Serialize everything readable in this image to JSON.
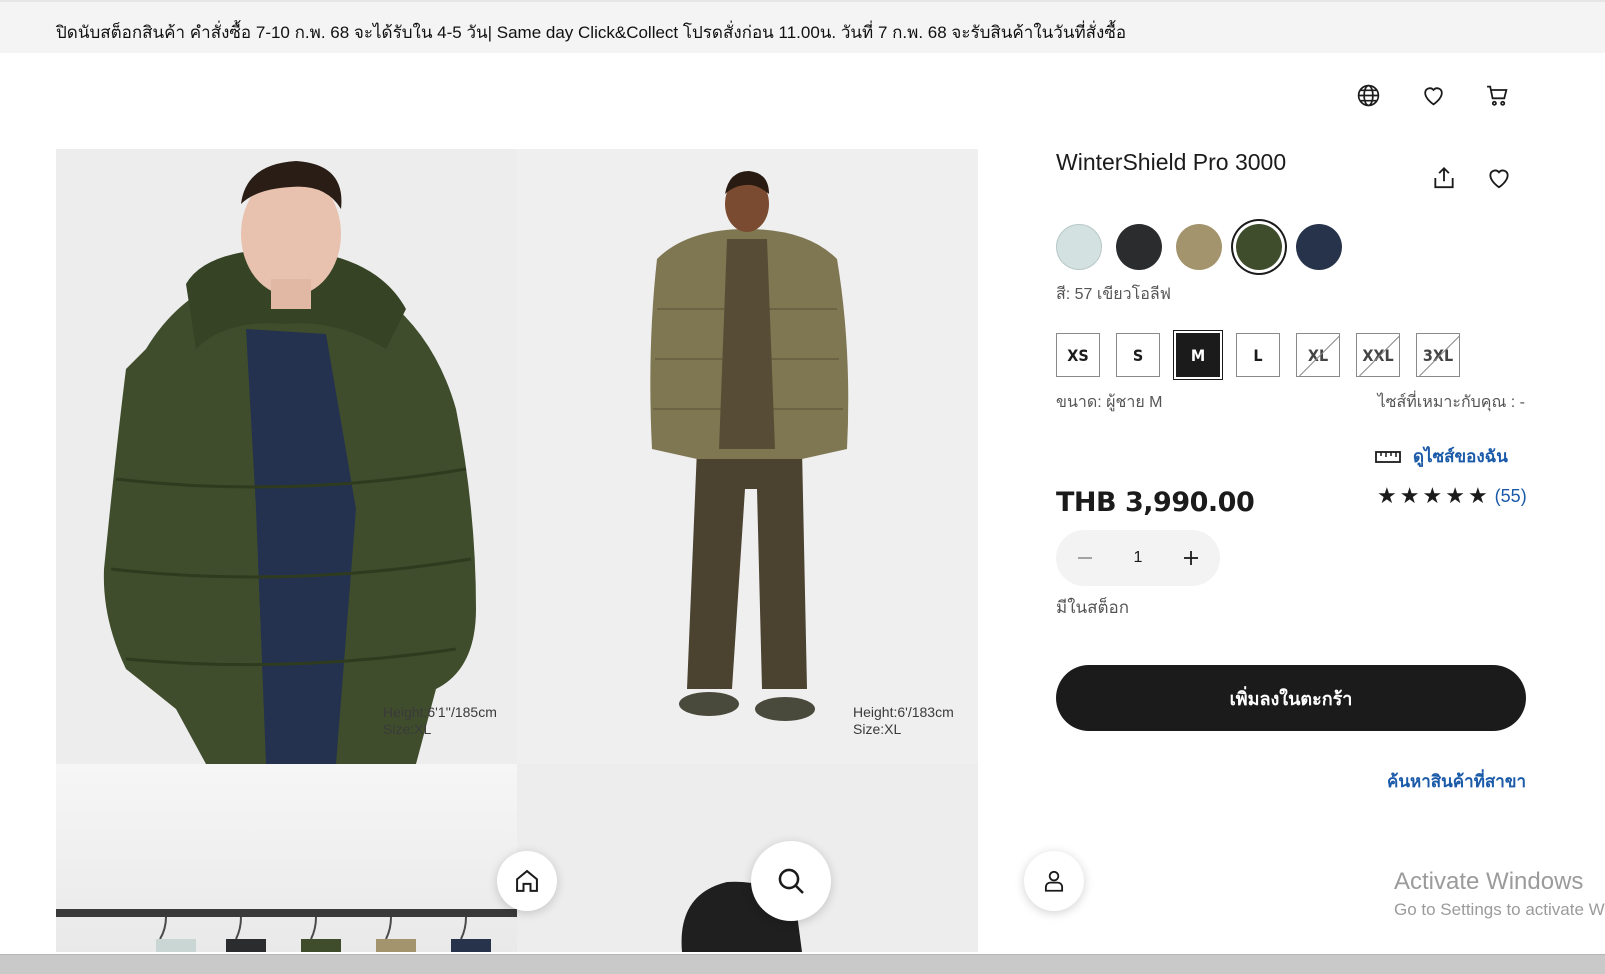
{
  "banner": {
    "text": "ปิดนับสต็อกสินค้า คำสั่งซื้อ 7-10 ก.พ. 68 จะได้รับใน 4-5 วัน| Same day Click&Collect โปรดสั่งก่อน 11.00น. วันที่ 7 ก.พ. 68 จะรับสินค้าในวันที่สั่งซื้อ"
  },
  "header": {
    "icons": [
      "globe-icon",
      "heart-icon",
      "cart-icon"
    ]
  },
  "gallery": {
    "captions": [
      {
        "height": "Height:6'1''/185cm",
        "size": "Size:XL"
      },
      {
        "height": "Height:6'/183cm",
        "size": "Size:XL"
      }
    ]
  },
  "product": {
    "title": "WinterShield Pro 3000",
    "color_label": "สี: 57 เขียวโอลีฟ",
    "colors": [
      {
        "name": "light-blue",
        "hex": "#d3e1e0"
      },
      {
        "name": "black",
        "hex": "#2b2c2e"
      },
      {
        "name": "beige",
        "hex": "#a4946d"
      },
      {
        "name": "olive",
        "hex": "#3f4d2c"
      },
      {
        "name": "navy",
        "hex": "#27324b"
      }
    ],
    "selected_color_index": 3,
    "sizes": [
      {
        "label": "XS",
        "available": true
      },
      {
        "label": "S",
        "available": true
      },
      {
        "label": "M",
        "available": true
      },
      {
        "label": "L",
        "available": true
      },
      {
        "label": "XL",
        "available": false
      },
      {
        "label": "XXL",
        "available": false
      },
      {
        "label": "3XL",
        "available": false
      }
    ],
    "selected_size_index": 2,
    "size_label": "ขนาด: ผู้ชาย M",
    "fit_label": "ไซส์ที่เหมาะกับคุณ : -",
    "my_size_link": "ดูไซส์ของฉัน",
    "price": "THB 3,990.00",
    "rating_count": "(55)",
    "rating_stars": 5,
    "quantity": "1",
    "stock": "มีในสต็อก",
    "add_to_cart": "เพิ่มลงในตะกร้า",
    "find_store": "ค้นหาสินค้าที่สาขา"
  },
  "bottom_nav": [
    "home-icon",
    "search-icon",
    "account-icon"
  ],
  "watermark": {
    "line1": "Activate Windows",
    "line2": "Go to Settings to activate Wi"
  },
  "colors": {
    "link": "#1a5aa8",
    "primary": "#1b1b1b"
  }
}
